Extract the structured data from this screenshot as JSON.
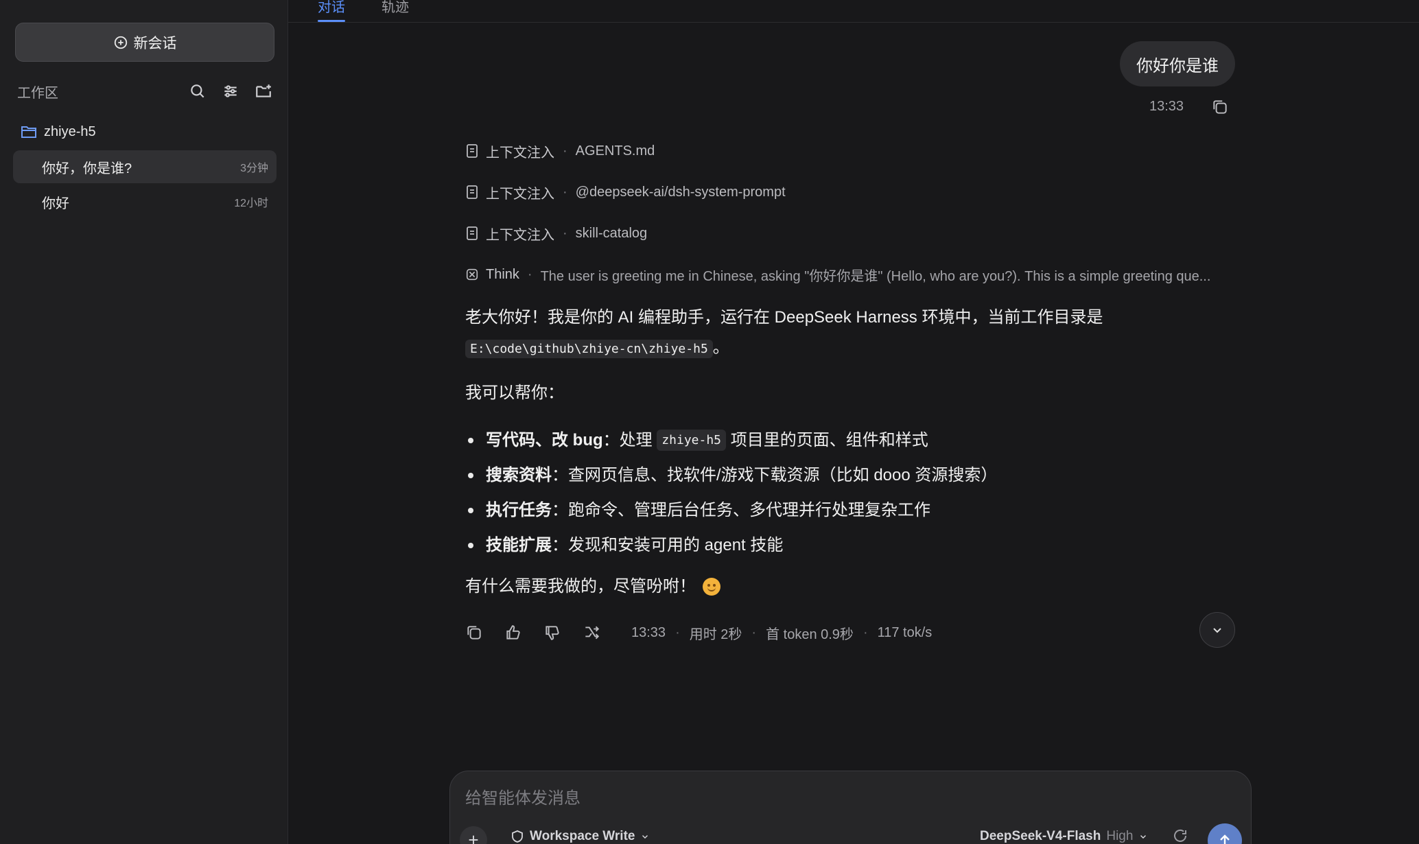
{
  "sidebar": {
    "new_chat_label": "新会话",
    "workspace_title": "工作区",
    "folder_name": "zhiye-h5",
    "sessions": [
      {
        "title": "你好，你是谁?",
        "time": "3分钟"
      },
      {
        "title": "你好",
        "time": "12小时"
      }
    ]
  },
  "tabs": [
    {
      "label": "对话"
    },
    {
      "label": "轨迹"
    }
  ],
  "user_message": {
    "text": "你好你是谁",
    "time": "13:33"
  },
  "context_items": [
    {
      "label": "上下文注入",
      "detail": "AGENTS.md"
    },
    {
      "label": "上下文注入",
      "detail": "@deepseek-ai/dsh-system-prompt"
    },
    {
      "label": "上下文注入",
      "detail": "skill-catalog"
    }
  ],
  "think": {
    "label": "Think",
    "detail": "The user is greeting me in Chinese, asking \"你好你是谁\" (Hello, who are you?). This is a simple greeting que..."
  },
  "answer": {
    "intro": "老大你好！我是你的 AI 编程助手，运行在 DeepSeek Harness 环境中，当前工作目录是",
    "path": "E:\\code\\github\\zhiye-cn\\zhiye-h5",
    "intro_end": "。",
    "can_help": "我可以帮你：",
    "bullets": [
      {
        "bold": "写代码、改 bug",
        "pre": "：处理 ",
        "code": "zhiye-h5",
        "post": " 项目里的页面、组件和样式"
      },
      {
        "bold": "搜索资料",
        "text": "：查网页信息、找软件/游戏下载资源（比如 dooo 资源搜索）"
      },
      {
        "bold": "执行任务",
        "text": "：跑命令、管理后台任务、多代理并行处理复杂工作"
      },
      {
        "bold": "技能扩展",
        "text": "：发现和安装可用的 agent 技能"
      }
    ],
    "closing": "有什么需要我做的，尽管吩咐！"
  },
  "message_meta": {
    "time": "13:33",
    "duration": "用时 2秒",
    "first_token": "首 token 0.9秒",
    "speed": "117 tok/s"
  },
  "composer": {
    "placeholder": "给智能体发消息",
    "permission": "Workspace Write",
    "model": "DeepSeek-V4-Flash",
    "level": "High"
  },
  "colors": {
    "accent": "#5b8ff9",
    "background": "#18181a",
    "sidebar": "#1f1f21"
  }
}
